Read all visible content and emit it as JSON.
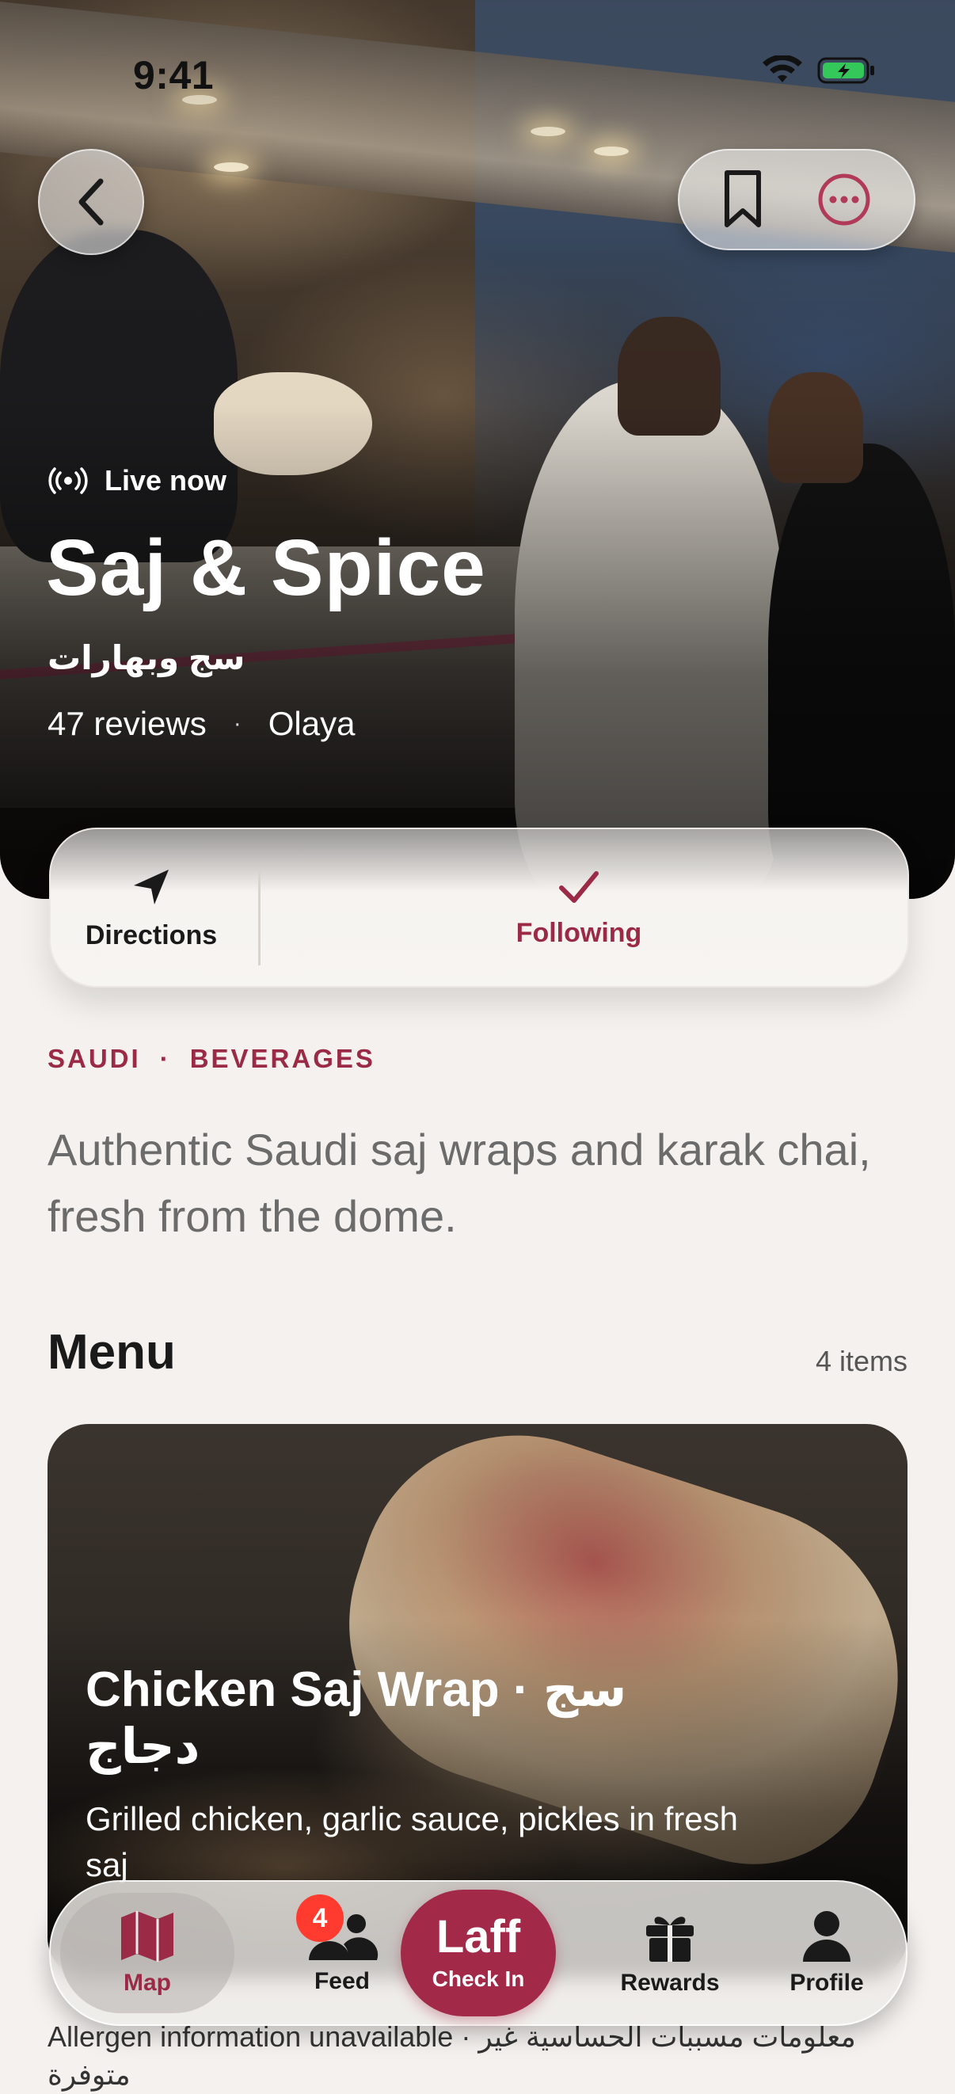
{
  "status": {
    "time": "9:41"
  },
  "hero": {
    "live_label": "Live now",
    "title": "Saj & Spice",
    "title_ar": "سج وبهارات",
    "reviews": "47 reviews",
    "location": "Olaya"
  },
  "actions": {
    "directions_label": "Directions",
    "following_label": "Following"
  },
  "tags": [
    "SAUDI",
    "BEVERAGES"
  ],
  "description": "Authentic Saudi saj wraps and karak chai, fresh from the dome.",
  "menu": {
    "heading": "Menu",
    "count": "4 items",
    "items": [
      {
        "title": "Chicken Saj Wrap · سج دجاج",
        "description": "Grilled chicken, garlic sauce, pickles in fresh saj",
        "allergen": "Allergen information unavailable · معلومات مسببات الحساسية غير متوفرة"
      }
    ]
  },
  "tabbar": {
    "map": "Map",
    "feed": "Feed",
    "feed_badge": "4",
    "checkin_brand": "Laff",
    "checkin_label": "Check In",
    "rewards": "Rewards",
    "profile": "Profile"
  },
  "colors": {
    "accent": "#9a2a45",
    "checkin": "#a22948",
    "badge": "#ff3b30",
    "background": "#f4f1ee"
  },
  "icons": [
    "back-chevron-icon",
    "bookmark-icon",
    "more-icon",
    "live-broadcast-icon",
    "navigation-arrow-icon",
    "checkmark-icon",
    "map-icon",
    "people-icon",
    "gift-icon",
    "person-icon"
  ]
}
